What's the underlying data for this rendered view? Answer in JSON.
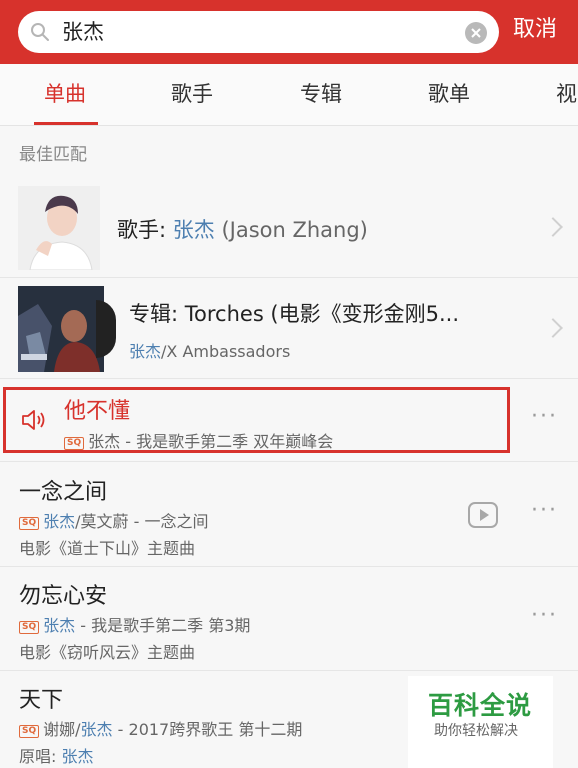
{
  "search": {
    "value": "张杰",
    "cancel_label": "取消"
  },
  "tabs": [
    {
      "label": "单曲",
      "active": true
    },
    {
      "label": "歌手"
    },
    {
      "label": "专辑"
    },
    {
      "label": "歌单"
    },
    {
      "label": "视"
    }
  ],
  "best_match": {
    "section_label": "最佳匹配",
    "artist": {
      "prefix": "歌手: ",
      "name": "张杰",
      "alias": " (Jason Zhang)"
    },
    "album": {
      "prefix": "专辑: ",
      "title": "Torches (电影《变形金刚5...",
      "artist_a": "张杰",
      "artist_b": "/X Ambassadors"
    }
  },
  "songs": [
    {
      "title": "他不懂",
      "quality": "SQ",
      "artist": "张杰",
      "info": " - 我是歌手第二季 双年巅峰会",
      "playing": true
    },
    {
      "title": "一念之间",
      "quality": "SQ",
      "artist": "张杰",
      "artist_extra": "/莫文蔚",
      "info": " - 一念之间",
      "note": "电影《道士下山》主题曲",
      "has_mv": true
    },
    {
      "title": "勿忘心安",
      "quality": "SQ",
      "artist": "张杰",
      "info": " - 我是歌手第二季 第3期",
      "note": "电影《窃听风云》主题曲"
    },
    {
      "title": "天下",
      "quality": "SQ",
      "artist_extra_pre": "谢娜/",
      "artist": "张杰",
      "info": " - 2017跨界歌王 第十二期",
      "note_prefix": "原唱: ",
      "note_artist": "张杰"
    }
  ],
  "more_label": "···",
  "watermark": {
    "title": "百科全说",
    "subtitle": "助你轻松解决"
  },
  "colors": {
    "accent": "#d7322c",
    "link": "#4d7fb0",
    "quality_badge": "#e06a3c",
    "watermark": "#2d9b42"
  }
}
